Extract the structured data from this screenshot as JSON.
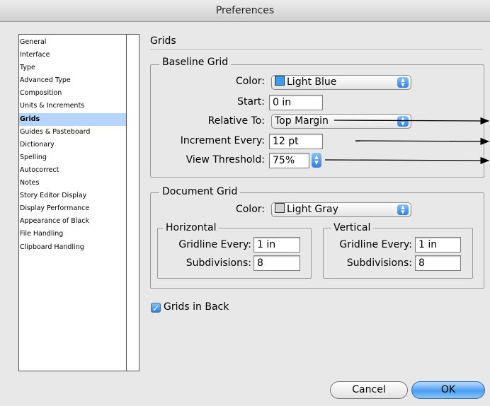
{
  "window": {
    "title": "Preferences"
  },
  "sidebar": {
    "items": [
      {
        "label": "General"
      },
      {
        "label": "Interface"
      },
      {
        "label": "Type"
      },
      {
        "label": "Advanced Type"
      },
      {
        "label": "Composition"
      },
      {
        "label": "Units & Increments"
      },
      {
        "label": "Grids",
        "selected": true
      },
      {
        "label": "Guides & Pasteboard"
      },
      {
        "label": "Dictionary"
      },
      {
        "label": "Spelling"
      },
      {
        "label": "Autocorrect"
      },
      {
        "label": "Notes"
      },
      {
        "label": "Story Editor Display"
      },
      {
        "label": "Display Performance"
      },
      {
        "label": "Appearance of Black"
      },
      {
        "label": "File Handling"
      },
      {
        "label": "Clipboard Handling"
      }
    ]
  },
  "panel": {
    "title": "Grids",
    "baseline_grid": {
      "label": "Baseline Grid",
      "color_label": "Color:",
      "color_value": "Light Blue",
      "color_swatch": "#3b9cf5",
      "start_label": "Start:",
      "start_value": "0 in",
      "relative_label": "Relative To:",
      "relative_value": "Top Margin",
      "increment_label": "Increment Every:",
      "increment_value": "12 pt",
      "threshold_label": "View Threshold:",
      "threshold_value": "75%"
    },
    "document_grid": {
      "label": "Document Grid",
      "color_label": "Color:",
      "color_value": "Light Gray",
      "color_swatch": "#d3d3d3",
      "horizontal": {
        "label": "Horizontal",
        "gridline_label": "Gridline Every:",
        "gridline_value": "1 in",
        "subdivisions_label": "Subdivisions:",
        "subdivisions_value": "8"
      },
      "vertical": {
        "label": "Vertical",
        "gridline_label": "Gridline Every:",
        "gridline_value": "1 in",
        "subdivisions_label": "Subdivisions:",
        "subdivisions_value": "8"
      }
    },
    "grids_in_back": {
      "label": "Grids in Back",
      "checked": true
    }
  },
  "buttons": {
    "cancel": "Cancel",
    "ok": "OK"
  }
}
